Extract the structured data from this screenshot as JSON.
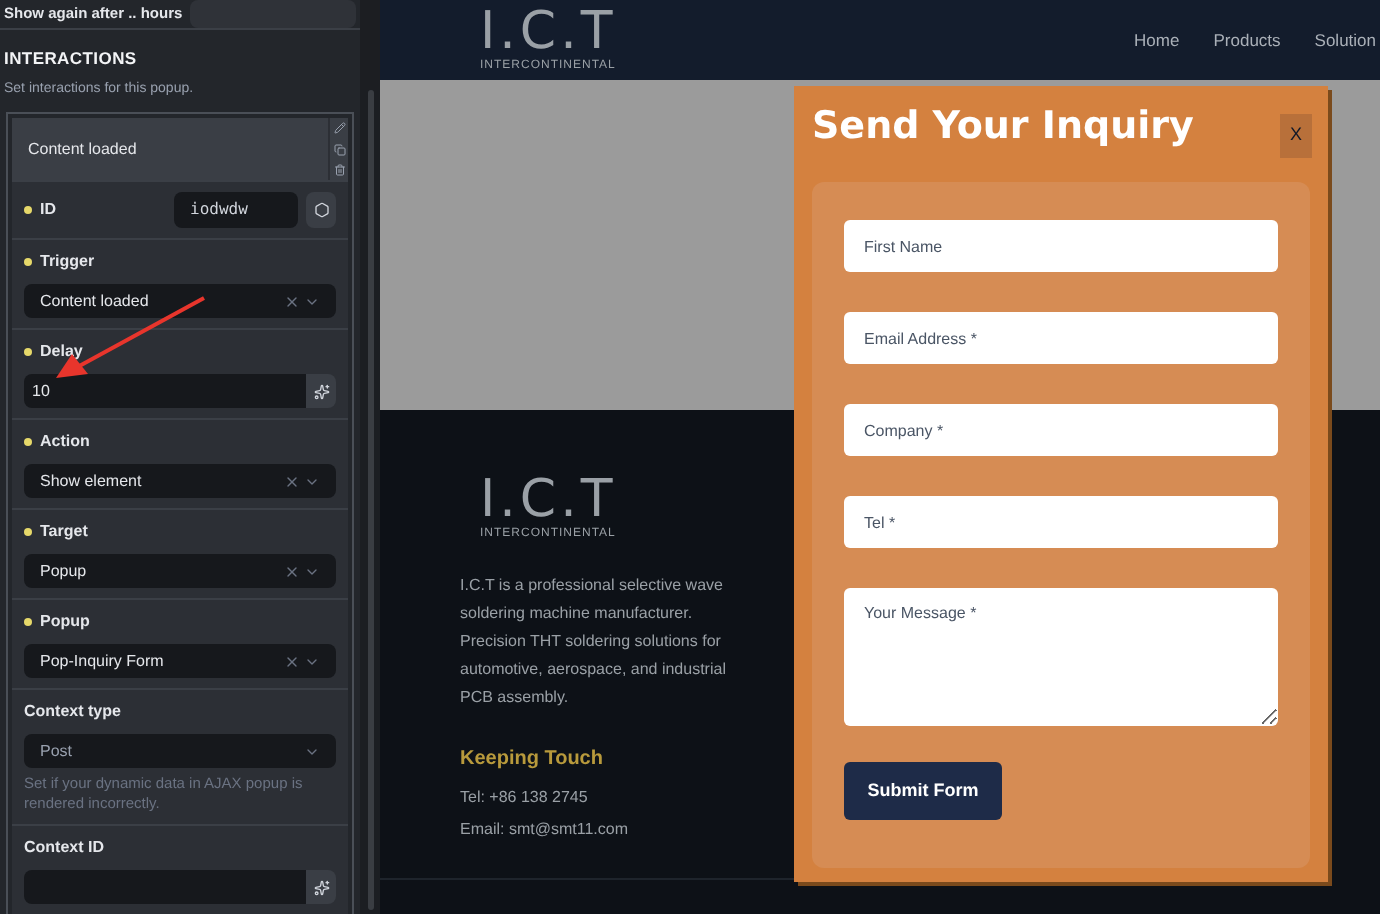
{
  "panel": {
    "show_again_label": "Show again after .. hours",
    "section_title": "INTERACTIONS",
    "section_description": "Set interactions for this popup.",
    "interaction_title": "Content loaded",
    "controls": [
      {
        "label": "ID",
        "marked": true,
        "kind": "text-button",
        "value": "iodwdw"
      },
      {
        "label": "Trigger",
        "marked": true,
        "kind": "select",
        "value": "Content loaded",
        "clearable": true
      },
      {
        "label": "Delay",
        "marked": true,
        "kind": "dynamic",
        "value": "10",
        "annotated": true
      },
      {
        "label": "Action",
        "marked": true,
        "kind": "select",
        "value": "Show element",
        "clearable": true
      },
      {
        "label": "Target",
        "marked": true,
        "kind": "select",
        "value": "Popup",
        "clearable": true
      },
      {
        "label": "Popup",
        "marked": true,
        "kind": "select",
        "value": "Pop-Inquiry Form",
        "clearable": true
      },
      {
        "label": "Context type",
        "marked": false,
        "kind": "select",
        "placeholder": "Post",
        "clearable": false,
        "help": "Set if your dynamic data in AJAX popup is rendered incorrectly."
      },
      {
        "label": "Context ID",
        "marked": false,
        "kind": "dynamic"
      }
    ]
  },
  "site": {
    "logo": "I.C.T",
    "logo_sub": "INTERCONTINENTAL",
    "nav": [
      "Home",
      "Products",
      "Solution"
    ],
    "footer": {
      "logo": "I.C.T",
      "logo_sub": "INTERCONTINENTAL",
      "about": "I.C.T is a professional selective wave soldering machine manufacturer. Precision THT soldering solutions for automotive, aerospace, and industrial PCB assembly.",
      "contact_title": "Keeping Touch",
      "tel": "Tel: +86 138 2745",
      "email": "Email: smt@smt11.com"
    }
  },
  "popup": {
    "title": "Send Your Inquiry",
    "close": "X",
    "fields": [
      {
        "kind": "input",
        "placeholder": "First Name"
      },
      {
        "kind": "input",
        "placeholder": "Email Address *"
      },
      {
        "kind": "input",
        "placeholder": "Company *"
      },
      {
        "kind": "input",
        "placeholder": "Tel *"
      },
      {
        "kind": "textarea",
        "placeholder": "Your Message *"
      }
    ],
    "submit": "Submit Form"
  }
}
